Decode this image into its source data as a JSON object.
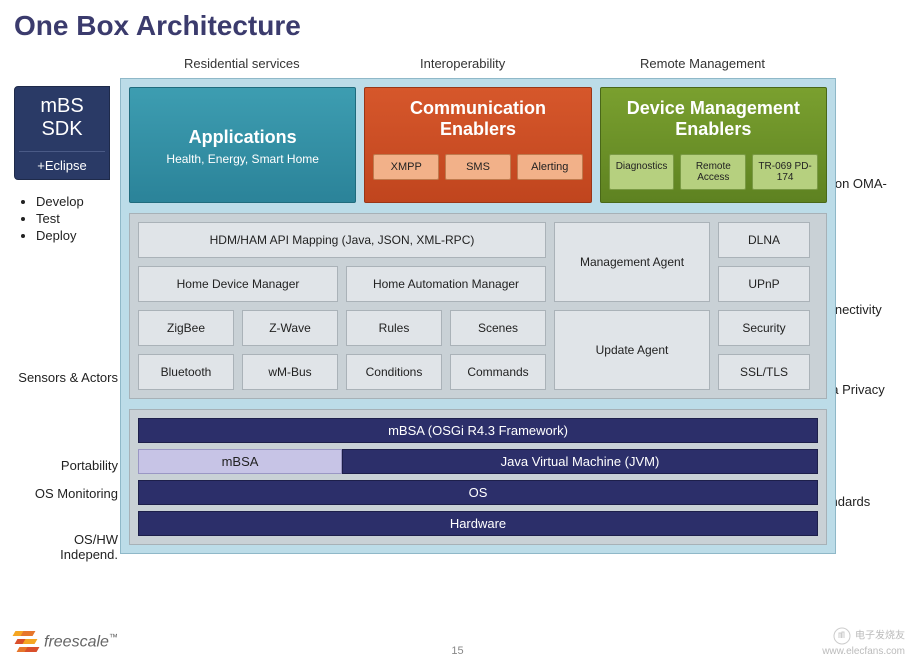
{
  "title": "One Box Architecture",
  "top_headers": {
    "residential": "Residential services",
    "interop": "Interoperability",
    "remote": "Remote Management"
  },
  "sdk": {
    "line1": "mBS",
    "line2": "SDK",
    "line3": "+Eclipse",
    "bullets": [
      "Develop",
      "Test",
      "Deploy"
    ]
  },
  "left_labels": {
    "sensors": "Sensors & Actors",
    "portability": "Portability",
    "osmon": "OS Monitoring",
    "oshw": "OS/HW Independ."
  },
  "right_labels": {
    "option": "Option OMA-DM",
    "connectivity": "Connectivity",
    "privacy": "Data Privacy",
    "standards": "Standards"
  },
  "big_boxes": {
    "apps": {
      "title": "Applications",
      "sub": "Health, Energy, Smart Home"
    },
    "comm": {
      "title": "Communication Enablers",
      "pills": [
        "XMPP",
        "SMS",
        "Alerting"
      ]
    },
    "devmgt": {
      "title": "Device Management Enablers",
      "pills": [
        "Diagnostics",
        "Remote Access",
        "TR-069 PD-174"
      ]
    }
  },
  "mid": {
    "api": "HDM/HAM API Mapping (Java, JSON, XML-RPC)",
    "mgmt_agent": "Management Agent",
    "dlna": "DLNA",
    "hdm": "Home Device Manager",
    "ham": "Home Automation Manager",
    "upnp": "UPnP",
    "zigbee": "ZigBee",
    "zwave": "Z-Wave",
    "rules": "Rules",
    "scenes": "Scenes",
    "update_agent": "Update Agent",
    "security": "Security",
    "bluetooth": "Bluetooth",
    "wmbus": "wM-Bus",
    "conditions": "Conditions",
    "commands": "Commands",
    "ssltls": "SSL/TLS"
  },
  "stack": {
    "osgi": "mBSA (OSGi R4.3 Framework)",
    "mbsa": "mBSA",
    "jvm": "Java Virtual Machine (JVM)",
    "os": "OS",
    "hw": "Hardware"
  },
  "footer": {
    "logo": "freescale",
    "tm": "™",
    "page": "15",
    "watermark1": "电子发烧友",
    "watermark2": "www.elecfans.com"
  }
}
